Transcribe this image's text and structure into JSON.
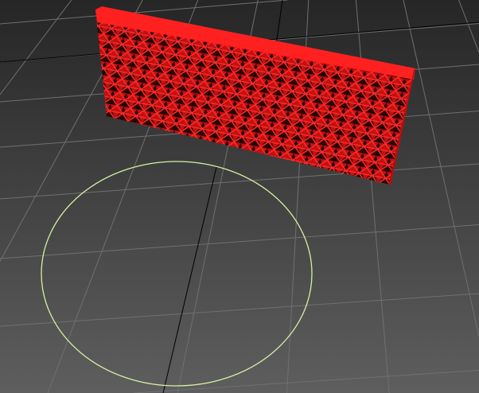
{
  "viewport": {
    "colors": {
      "bg_top": "#262626",
      "bg_bottom": "#5e5e5e",
      "grid": "#707070",
      "axis": "#000000",
      "object": "#e81818",
      "object_shade": "#6a0808",
      "spline": "#d6f0a4"
    },
    "icons": [
      "wall-mesh-object",
      "circle-spline",
      "ground-grid"
    ]
  }
}
